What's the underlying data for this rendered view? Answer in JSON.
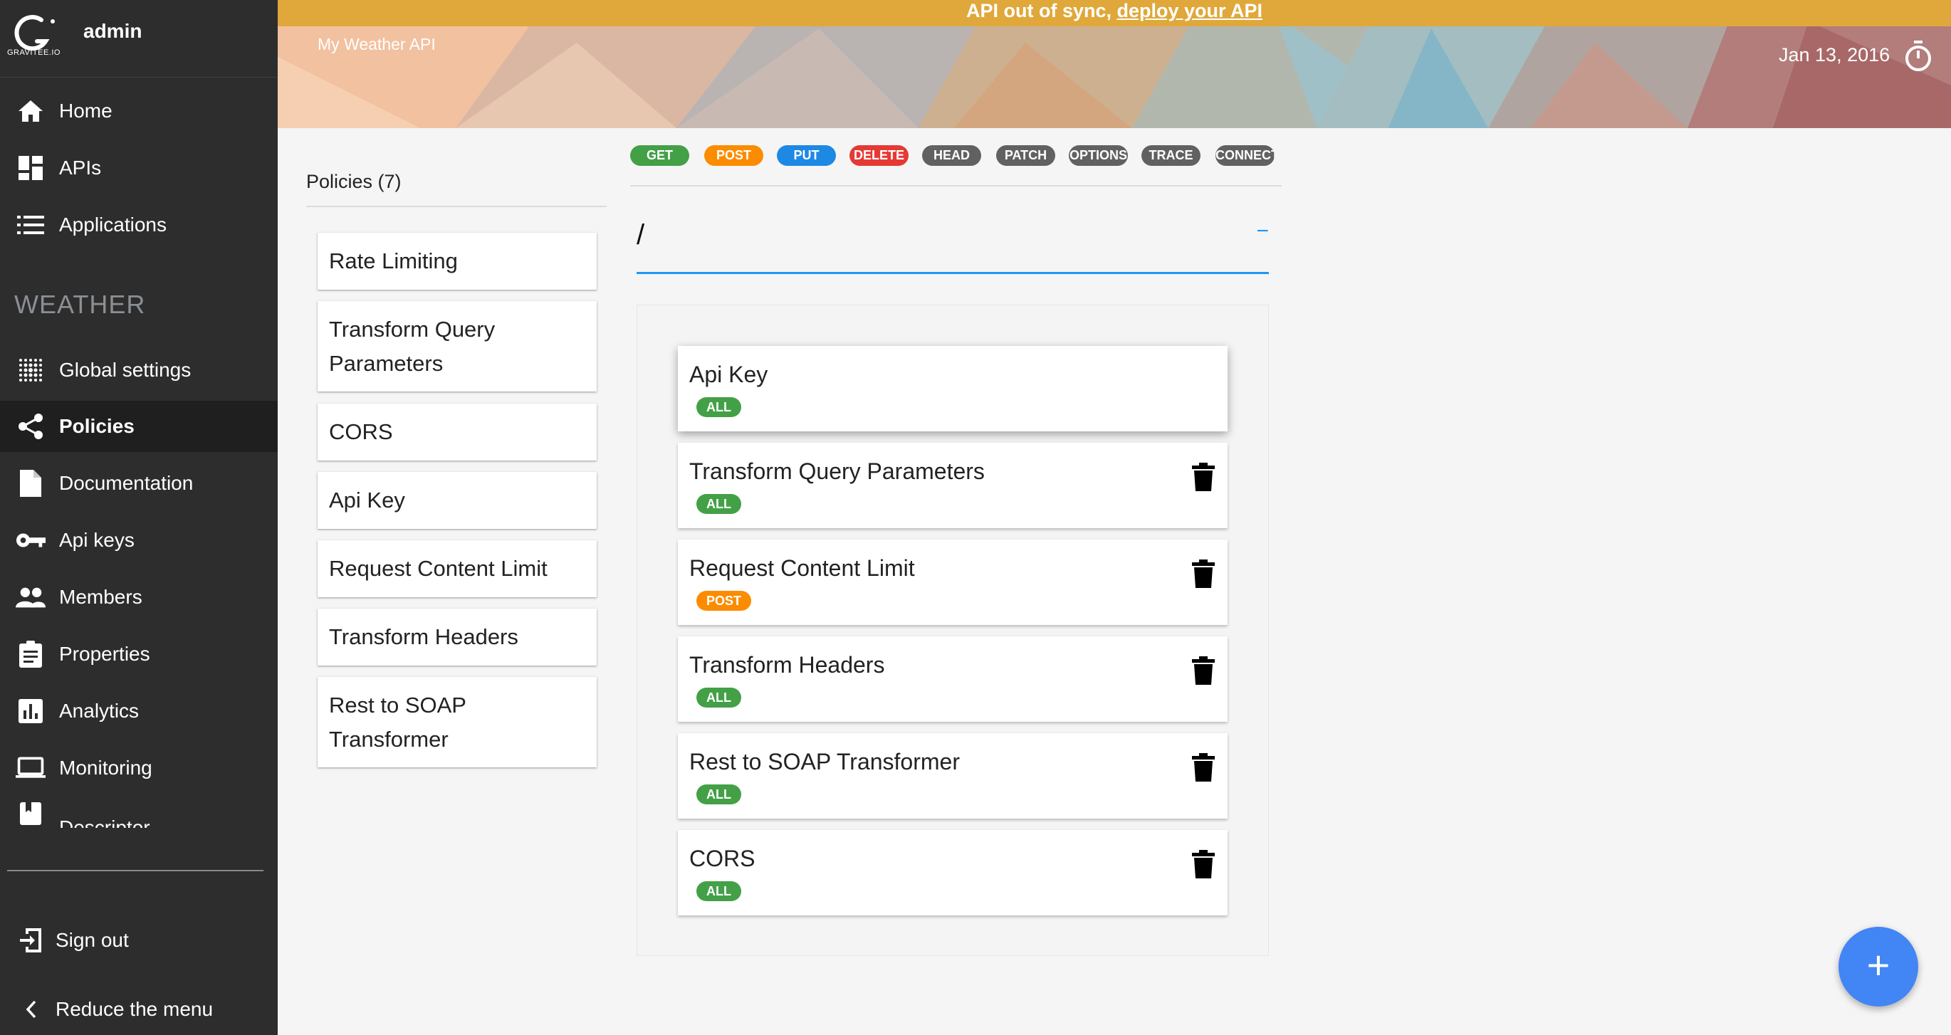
{
  "sidebar": {
    "logo_text": "GRAVITEE.IO",
    "username": "admin",
    "top_items": [
      {
        "label": "Home",
        "icon": "home-icon"
      },
      {
        "label": "APIs",
        "icon": "dashboard-icon"
      },
      {
        "label": "Applications",
        "icon": "list-icon"
      }
    ],
    "section_title": "WEATHER",
    "api_items": [
      {
        "label": "Global settings",
        "icon": "settings-dots-icon"
      },
      {
        "label": "Policies",
        "icon": "share-icon",
        "active": true
      },
      {
        "label": "Documentation",
        "icon": "document-icon"
      },
      {
        "label": "Api keys",
        "icon": "key-icon"
      },
      {
        "label": "Members",
        "icon": "people-icon"
      },
      {
        "label": "Properties",
        "icon": "clipboard-icon"
      },
      {
        "label": "Analytics",
        "icon": "bar-chart-icon"
      },
      {
        "label": "Monitoring",
        "icon": "laptop-icon"
      },
      {
        "label": "Descriptor",
        "icon": "book-icon"
      }
    ],
    "sign_out": "Sign out",
    "reduce_menu": "Reduce the menu"
  },
  "header": {
    "sync_text": "API out of sync, ",
    "sync_link": "deploy your API",
    "api_name": "My Weather API",
    "date": "Jan 13, 2016",
    "colors": {
      "banner": "#e0a83a"
    }
  },
  "policies": {
    "title": "Policies (7)",
    "items": [
      "Rate Limiting",
      "Transform Query Parameters",
      "CORS",
      "Api Key",
      "Request Content Limit",
      "Transform Headers",
      "Rest to SOAP Transformer"
    ]
  },
  "methods": [
    {
      "label": "GET",
      "color": "#43a047"
    },
    {
      "label": "POST",
      "color": "#fb8c00"
    },
    {
      "label": "PUT",
      "color": "#1e88e5"
    },
    {
      "label": "DELETE",
      "color": "#e53935"
    },
    {
      "label": "HEAD",
      "color": "#616161"
    },
    {
      "label": "PATCH",
      "color": "#616161"
    },
    {
      "label": "OPTIONS",
      "color": "#616161"
    },
    {
      "label": "TRACE",
      "color": "#616161"
    },
    {
      "label": "CONNECT",
      "color": "#616161"
    }
  ],
  "path": {
    "value": "/",
    "collapse_symbol": "−"
  },
  "flow": [
    {
      "name": "Api Key",
      "badge": "ALL",
      "badge_color": "#43a047",
      "deletable": false
    },
    {
      "name": "Transform Query Parameters",
      "badge": "ALL",
      "badge_color": "#43a047",
      "deletable": true
    },
    {
      "name": "Request Content Limit",
      "badge": "POST",
      "badge_color": "#fb8c00",
      "deletable": true
    },
    {
      "name": "Transform Headers",
      "badge": "ALL",
      "badge_color": "#43a047",
      "deletable": true
    },
    {
      "name": "Rest to SOAP Transformer",
      "badge": "ALL",
      "badge_color": "#43a047",
      "deletable": true
    },
    {
      "name": "CORS",
      "badge": "ALL",
      "badge_color": "#43a047",
      "deletable": true
    }
  ],
  "fab": {
    "symbol": "+"
  }
}
